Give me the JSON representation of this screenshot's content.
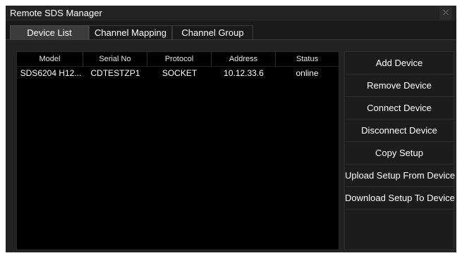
{
  "window": {
    "title": "Remote SDS Manager",
    "close_glyph": "✕"
  },
  "tabs": [
    {
      "label": "Device List",
      "active": true
    },
    {
      "label": "Channel Mapping",
      "active": false
    },
    {
      "label": "Channel Group",
      "active": false
    }
  ],
  "table": {
    "columns": [
      "Model",
      "Serial No",
      "Protocol",
      "Address",
      "Status"
    ],
    "rows": [
      [
        "SDS6204 H12...",
        "CDTESTZP1",
        "SOCKET",
        "10.12.33.6",
        "online"
      ]
    ]
  },
  "actions": [
    "Add Device",
    "Remove Device",
    "Connect Device",
    "Disconnect Device",
    "Copy Setup",
    "Upload Setup From Device",
    "Download Setup To Device"
  ],
  "icons": {
    "close": "close-icon"
  },
  "colors": {
    "window_bg": "#1a1a1a",
    "table_bg": "#000000",
    "active_tab": "#3c3c3c",
    "text": "#ffffff"
  }
}
